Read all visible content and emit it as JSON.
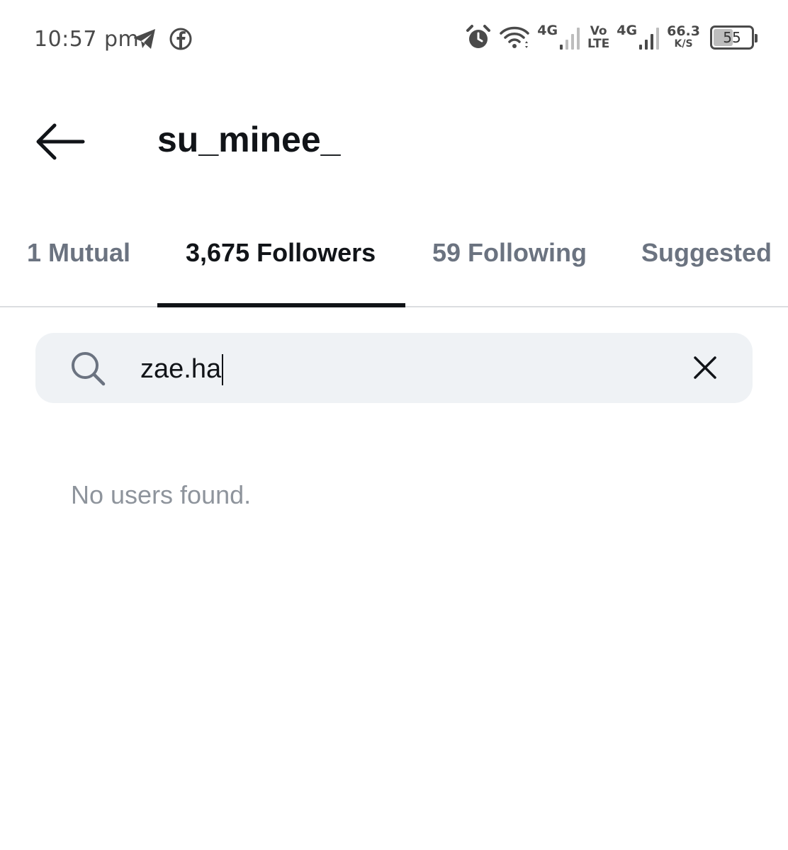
{
  "status_bar": {
    "time": "10:57 pm",
    "network_1": "4G",
    "volte_top": "Vo",
    "volte_bottom": "LTE",
    "network_2": "4G",
    "speed_value": "66.3",
    "speed_unit": "K/S",
    "battery_level": "55",
    "battery_fraction": 0.55,
    "left_icons": [
      "telegram-icon",
      "facebook-icon"
    ],
    "right_icons": [
      "alarm-icon",
      "wifi-icon",
      "signal-icon",
      "signal-icon",
      "battery-icon"
    ]
  },
  "header": {
    "title": "su_minee_",
    "back_icon": "back-arrow-icon"
  },
  "tabs": [
    {
      "label": "1 Mutual",
      "active": false
    },
    {
      "label": "3,675 Followers",
      "active": true
    },
    {
      "label": "59 Following",
      "active": false
    },
    {
      "label": "Suggested",
      "active": false
    }
  ],
  "search": {
    "value": "zae.ha",
    "icon": "search-icon",
    "clear_icon": "close-icon"
  },
  "results": {
    "empty_message": "No users found."
  },
  "colors": {
    "text_primary": "#111418",
    "text_secondary": "#6b7380",
    "search_background": "#eff2f5",
    "empty_text": "#8e949c",
    "divider": "#dbdde0"
  }
}
